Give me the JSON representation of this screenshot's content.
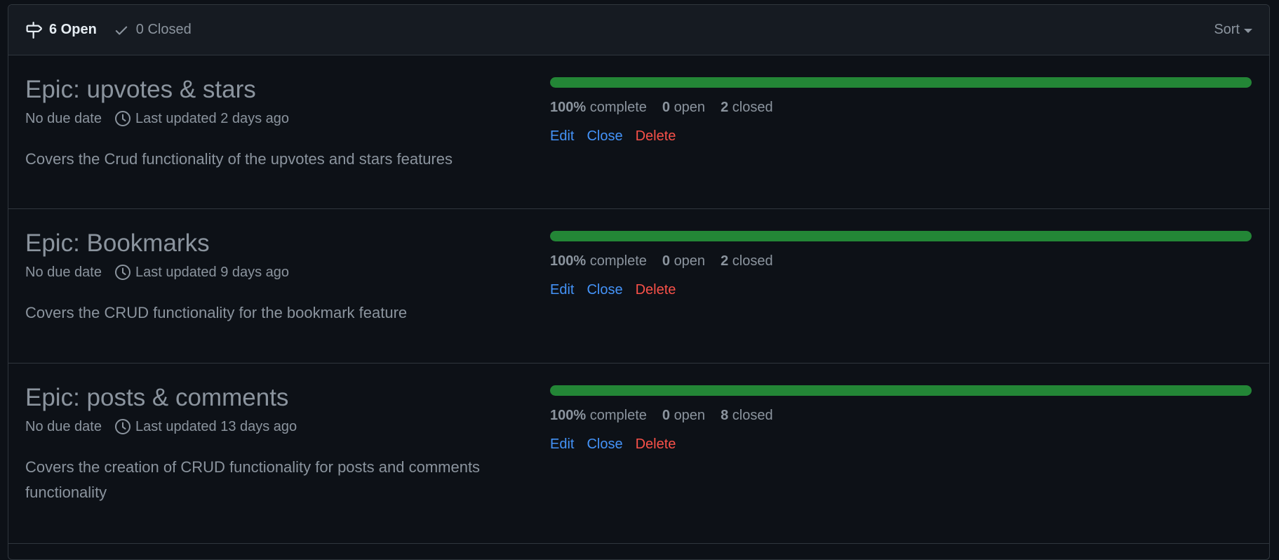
{
  "header": {
    "open_label": "6 Open",
    "closed_label": "0 Closed",
    "sort_label": "Sort"
  },
  "milestones": [
    {
      "title": "Epic: upvotes & stars",
      "due": "No due date",
      "updated": "Last updated 2 days ago",
      "description": "Covers the Crud functionality of the upvotes and stars features",
      "percent_complete": 100,
      "percent_label": "100%",
      "complete_label": "complete",
      "open_count": "0",
      "open_label": "open",
      "closed_count": "2",
      "closed_label": "closed",
      "edit": "Edit",
      "close": "Close",
      "delete": "Delete"
    },
    {
      "title": "Epic: Bookmarks",
      "due": "No due date",
      "updated": "Last updated 9 days ago",
      "description": "Covers the CRUD functionality for the bookmark feature",
      "percent_complete": 100,
      "percent_label": "100%",
      "complete_label": "complete",
      "open_count": "0",
      "open_label": "open",
      "closed_count": "2",
      "closed_label": "closed",
      "edit": "Edit",
      "close": "Close",
      "delete": "Delete"
    },
    {
      "title": "Epic: posts & comments",
      "due": "No due date",
      "updated": "Last updated 13 days ago",
      "description": "Covers the creation of CRUD functionality for posts and comments functionality",
      "percent_complete": 100,
      "percent_label": "100%",
      "complete_label": "complete",
      "open_count": "0",
      "open_label": "open",
      "closed_count": "8",
      "closed_label": "closed",
      "edit": "Edit",
      "close": "Close",
      "delete": "Delete"
    }
  ],
  "icons": {
    "open": "milestone-icon",
    "closed": "check-icon",
    "updated": "clock-icon"
  },
  "colors": {
    "background": "#0d1117",
    "header_bg": "#161b22",
    "border": "#30363d",
    "progress": "#238636",
    "link": "#4493f8",
    "danger": "#f85149",
    "muted": "#8b949e",
    "primary_text": "#e6edf3"
  }
}
